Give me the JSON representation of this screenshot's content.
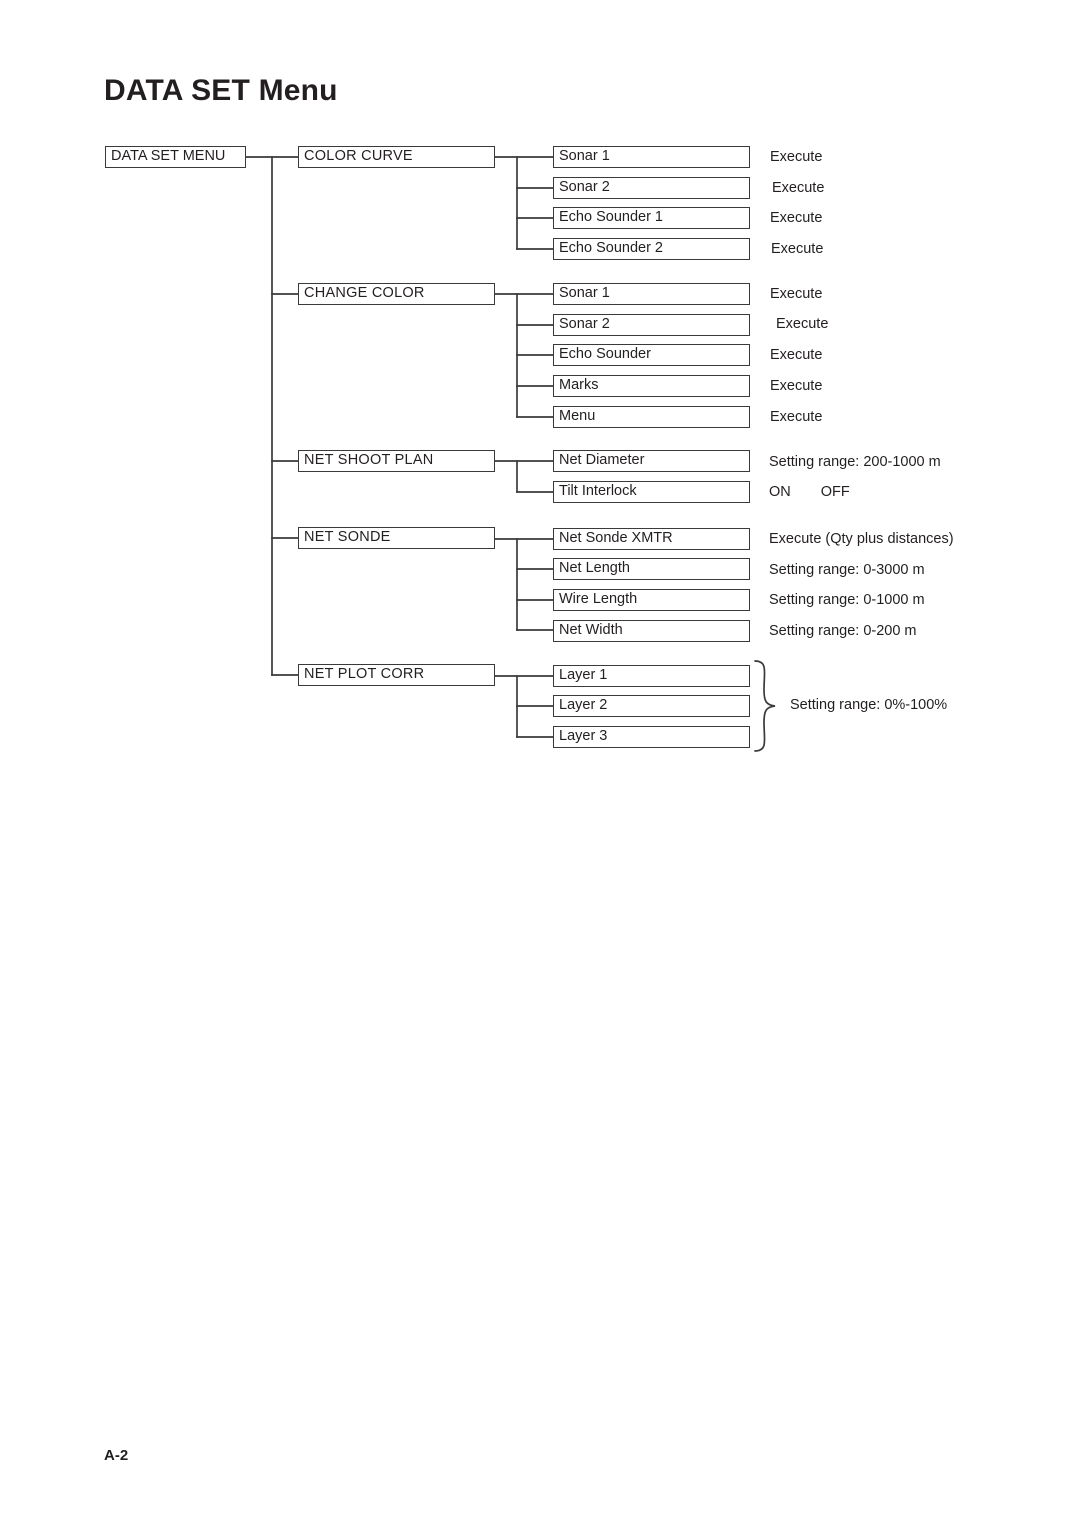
{
  "page": {
    "title": "DATA SET Menu",
    "number": "A-2"
  },
  "diagram": {
    "root": {
      "label": "DATA SET MENU"
    },
    "sections": [
      {
        "label": "COLOR CURVE",
        "items": [
          {
            "label": "Sonar 1",
            "annotation": "Execute"
          },
          {
            "label": "Sonar 2",
            "annotation": "Execute"
          },
          {
            "label": "Echo Sounder 1",
            "annotation": "Execute"
          },
          {
            "label": "Echo Sounder 2",
            "annotation": "Execute"
          }
        ]
      },
      {
        "label": "CHANGE COLOR",
        "items": [
          {
            "label": "Sonar 1",
            "annotation": "Execute"
          },
          {
            "label": "Sonar 2",
            "annotation": "Execute"
          },
          {
            "label": "Echo Sounder",
            "annotation": "Execute"
          },
          {
            "label": "Marks",
            "annotation": "Execute"
          },
          {
            "label": "Menu",
            "annotation": "Execute"
          }
        ]
      },
      {
        "label": "NET SHOOT PLAN",
        "items": [
          {
            "label": "Net Diameter",
            "annotation": "Setting range: 200-1000 m"
          },
          {
            "label": "Tilt Interlock",
            "annotation": "",
            "on": "ON",
            "off": "OFF"
          }
        ]
      },
      {
        "label": "NET SONDE",
        "items": [
          {
            "label": "Net Sonde XMTR",
            "annotation": "Execute (Qty plus distances)"
          },
          {
            "label": "Net Length",
            "annotation": "Setting range: 0-3000 m"
          },
          {
            "label": "Wire Length",
            "annotation": "Setting range: 0-1000 m"
          },
          {
            "label": "Net Width",
            "annotation": "Setting range: 0-200 m"
          }
        ]
      },
      {
        "label": "NET PLOT CORR",
        "items": [
          {
            "label": "Layer 1",
            "annotation": ""
          },
          {
            "label": "Layer 2",
            "annotation": ""
          },
          {
            "label": "Layer 3",
            "annotation": ""
          }
        ],
        "brace_annotation": "Setting range: 0%-100%"
      }
    ]
  },
  "colors": {
    "ink": "#231f20",
    "line": "#3a3a3a",
    "background": "#ffffff"
  }
}
